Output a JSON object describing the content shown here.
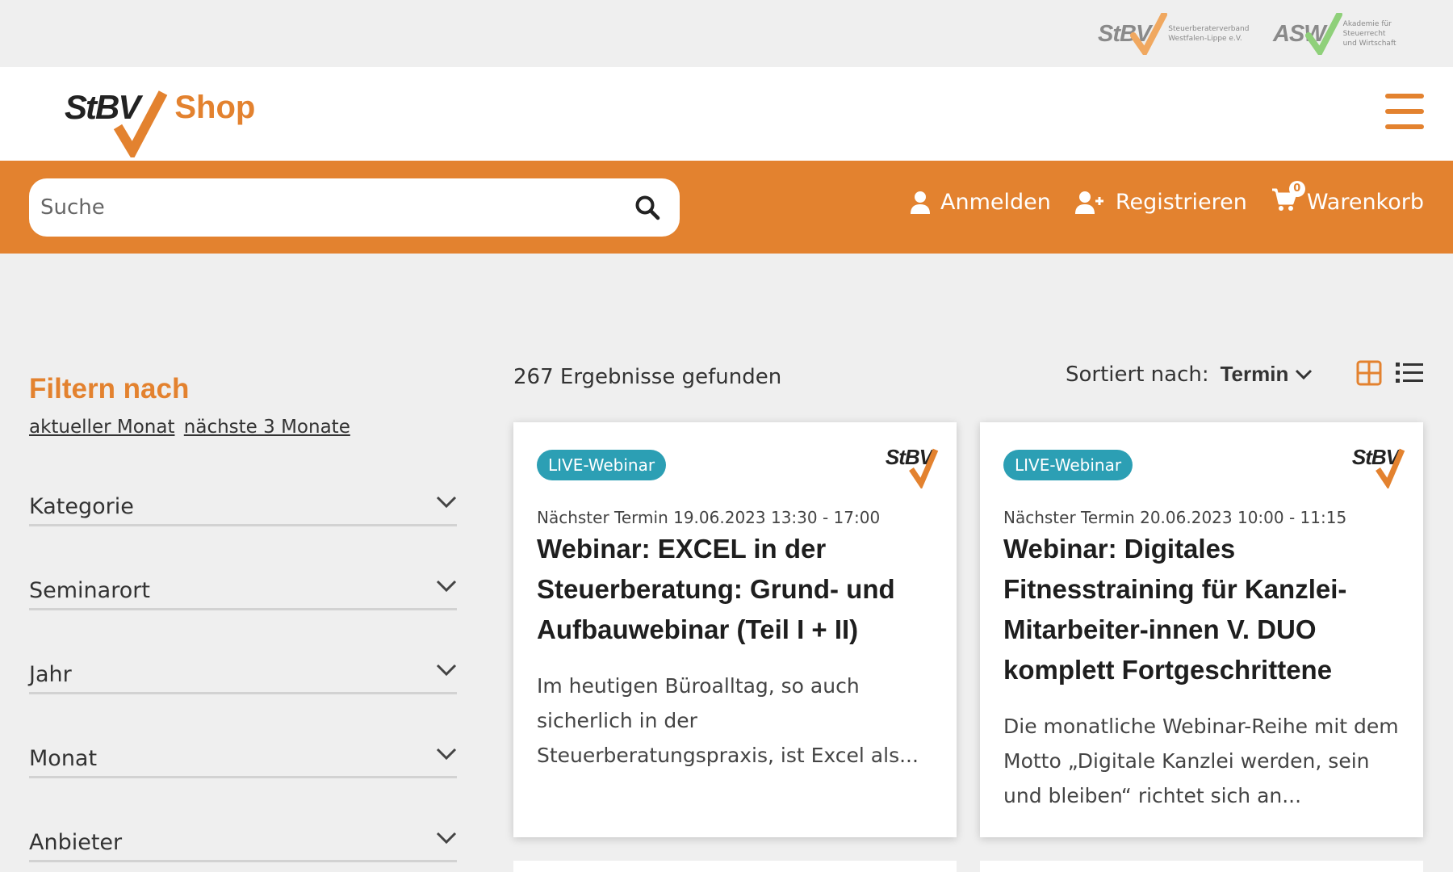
{
  "partners": {
    "stbv": {
      "mark": "StBV",
      "text_line1": "Steuerberaterverband",
      "text_line2": "Westfalen-Lippe e.V."
    },
    "asw": {
      "mark": "ASW",
      "text_line1": "Akademie für Steuerrecht",
      "text_line2": "und Wirtschaft"
    }
  },
  "header": {
    "logo_mark": "StBV",
    "logo_shop": "Shop"
  },
  "search": {
    "placeholder": "Suche"
  },
  "nav": {
    "login": "Anmelden",
    "register": "Registrieren",
    "cart": "Warenkorb",
    "cart_count": "0"
  },
  "sidebar": {
    "title": "Filtern nach",
    "quick_links": [
      "aktueller Monat",
      "nächste 3 Monate"
    ],
    "facets": [
      "Kategorie",
      "Seminarort",
      "Jahr",
      "Monat",
      "Anbieter"
    ]
  },
  "results": {
    "count_text": "267 Ergebnisse gefunden",
    "sort_label": "Sortiert nach:",
    "sort_value": "Termin"
  },
  "cards": [
    {
      "badge": "LIVE-Webinar",
      "logo": "StBV",
      "date": "Nächster Termin 19.06.2023 13:30 - 17:00",
      "title": "Webinar: EXCEL in der Steuerberatung: Grund- und Aufbauwebinar (Teil I + II)",
      "description": "Im heutigen Büroalltag, so auch sicherlich in der Steuerberatungspraxis, ist Excel als..."
    },
    {
      "badge": "LIVE-Webinar",
      "logo": "StBV",
      "date": "Nächster Termin 20.06.2023 10:00 - 11:15",
      "title": "Webinar: Digitales Fitnesstraining für Kanzlei-Mitarbeiter-innen V. DUO komplett Fortgeschrittene",
      "description": "Die monatliche Webinar-Reihe mit dem Motto „Digitale Kanzlei werden, sein und bleiben“ richtet sich an..."
    }
  ],
  "colors": {
    "accent": "#e3822f",
    "badge": "#2c9fb4",
    "partner_check_stbv": "#f0a860",
    "partner_check_asw": "#8fd07a"
  },
  "icons": {
    "search": "search-icon",
    "user": "user-icon",
    "user_plus": "user-plus-icon",
    "cart": "cart-icon",
    "menu": "hamburger-menu-icon",
    "chevron": "chevron-down-icon",
    "grid": "grid-view-icon",
    "list": "list-view-icon"
  }
}
